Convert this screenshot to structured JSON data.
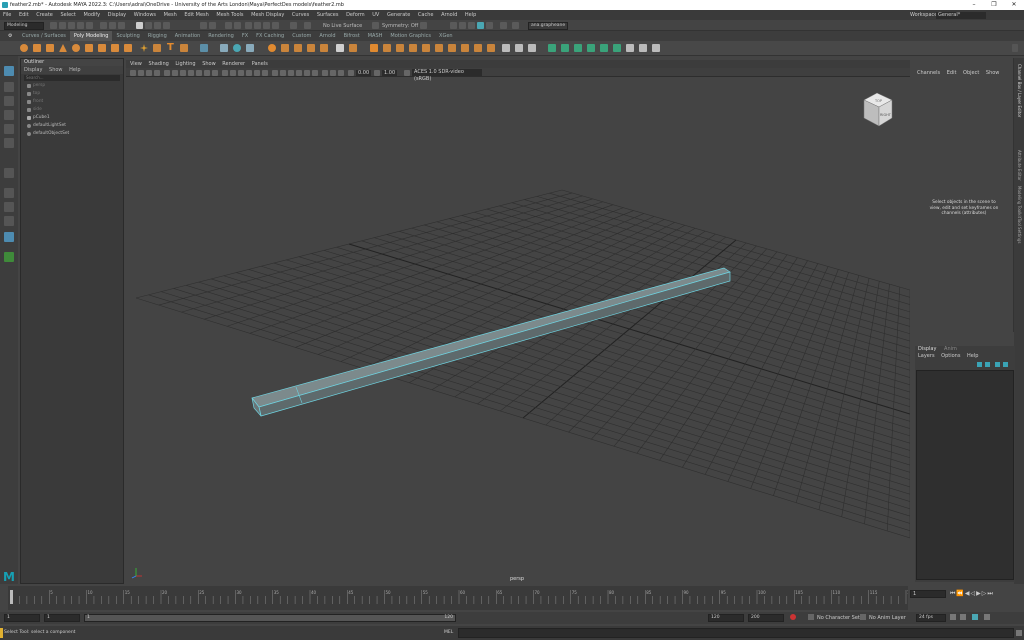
{
  "window": {
    "title": "feather2.mb* - Autodesk MAYA 2022.3: C:\\Users\\adrai\\OneDrive - University of the Arts London\\Maya\\PerfectDes models\\feather2.mb"
  },
  "menubar": {
    "items": [
      "File",
      "Edit",
      "Create",
      "Select",
      "Modify",
      "Display",
      "Windows",
      "Mesh",
      "Edit Mesh",
      "Mesh Tools",
      "Mesh Display",
      "Curves",
      "Surfaces",
      "Deform",
      "UV",
      "Generate",
      "Cache",
      "Arnold",
      "Help"
    ],
    "workspace_label": "Workspace :",
    "workspace_value": "General*"
  },
  "statusline": {
    "mode_value": "Modeling",
    "live_surface": "No Live Surface",
    "symmetry": "Symmetry: Off",
    "login": "ana.grapheane"
  },
  "shelf": {
    "tabs": [
      "Curves / Surfaces",
      "Poly Modeling",
      "Sculpting",
      "Rigging",
      "Animation",
      "Rendering",
      "FX",
      "FX Caching",
      "Custom",
      "Arnold",
      "Bifrost",
      "MASH",
      "Motion Graphics",
      "XGen"
    ],
    "active_tab": "Poly Modeling"
  },
  "outliner": {
    "title": "Outliner",
    "menu": [
      "Display",
      "Show",
      "Help"
    ],
    "search_placeholder": "Search...",
    "items": [
      {
        "label": "persp",
        "dim": true
      },
      {
        "label": "top",
        "dim": true
      },
      {
        "label": "front",
        "dim": true
      },
      {
        "label": "side",
        "dim": true
      },
      {
        "label": "pCube1",
        "dim": false
      },
      {
        "label": "defaultLightSet",
        "dim": false
      },
      {
        "label": "defaultObjectSet",
        "dim": false
      }
    ]
  },
  "viewport": {
    "menu": [
      "View",
      "Shading",
      "Lighting",
      "Show",
      "Renderer",
      "Panels"
    ],
    "exposure": "0.00",
    "gamma": "1.00",
    "color_space": "ACES 1.0 SDR-video (sRGB)",
    "camera_label": "persp",
    "viewcube_label": "RIGHT",
    "viewcube_top_label": "TOP",
    "accent_color": "#6fd3e0"
  },
  "channelbox": {
    "menu": [
      "Channels",
      "Edit",
      "Object",
      "Show"
    ],
    "message": "Select objects in the scene to view, edit and set keyframes on channels (attributes)"
  },
  "right_tabs": [
    "Channel Box / Layer Editor",
    "Attribute Editor",
    "Modeling Toolkit",
    "Tool Settings"
  ],
  "layer_editor": {
    "tabs": [
      "Display",
      "Anim"
    ],
    "menu": [
      "Layers",
      "Options",
      "Help"
    ]
  },
  "timeslider": {
    "ticks": [
      "5",
      "10",
      "15",
      "20",
      "25",
      "30",
      "35",
      "40",
      "45",
      "50",
      "55",
      "60",
      "65",
      "70",
      "75",
      "80",
      "85",
      "90",
      "95",
      "100",
      "105",
      "110",
      "115",
      "120"
    ],
    "current_frame": "1"
  },
  "range": {
    "start": "1",
    "start_inner": "1",
    "slider_start": "1",
    "slider_end": "120",
    "end_inner": "120",
    "end": "200",
    "character_set": "No Character Set",
    "anim_layer": "No Anim Layer",
    "fps": "24 fps"
  },
  "commandline": {
    "mel_label": "MEL",
    "help_text": "Select Tool: select a component"
  }
}
